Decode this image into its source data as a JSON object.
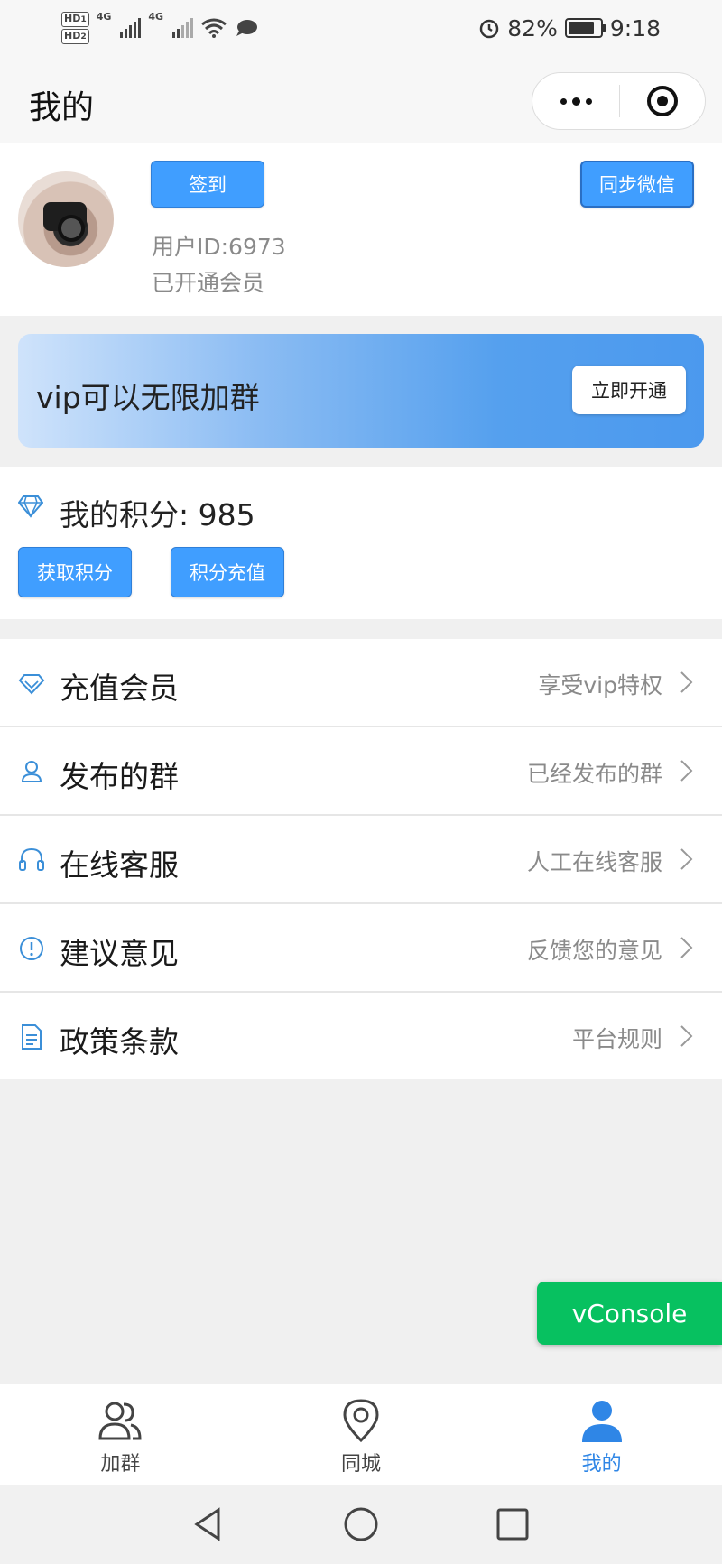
{
  "status_bar": {
    "network_1": "4G",
    "network_2": "4G",
    "battery": "82%",
    "time": "9:18",
    "hd1": "HD",
    "hd2": "HD",
    "sim1": "1",
    "sim2": "2",
    "battery_level": 0.82
  },
  "header": {
    "title": "我的"
  },
  "profile": {
    "checkin_label": "签到",
    "sync_label": "同步微信",
    "user_id": "用户ID:6973",
    "member_status": "已开通会员"
  },
  "vip_banner": {
    "text": "vip可以无限加群",
    "button_label": "立即开通"
  },
  "points": {
    "label": "我的积分: 985",
    "get_label": "获取积分",
    "recharge_label": "积分充值"
  },
  "menu": [
    {
      "label": "充值会员",
      "hint": "享受vip特权",
      "icon": "diamond-icon"
    },
    {
      "label": "发布的群",
      "hint": "已经发布的群",
      "icon": "person-icon"
    },
    {
      "label": "在线客服",
      "hint": "人工在线客服",
      "icon": "headset-icon"
    },
    {
      "label": "建议意见",
      "hint": "反馈您的意见",
      "icon": "alert-circle-icon"
    },
    {
      "label": "政策条款",
      "hint": "平台规则",
      "icon": "document-icon"
    }
  ],
  "vconsole_label": "vConsole",
  "tabs": [
    {
      "label": "加群",
      "icon": "group-icon",
      "active": false
    },
    {
      "label": "同城",
      "icon": "location-pin-icon",
      "active": false
    },
    {
      "label": "我的",
      "icon": "user-icon",
      "active": true
    }
  ],
  "colors": {
    "accent": "#409eff",
    "vconsole": "#07c160",
    "active_tab": "#2f86e6",
    "icon_blue": "#3b8fd8"
  }
}
